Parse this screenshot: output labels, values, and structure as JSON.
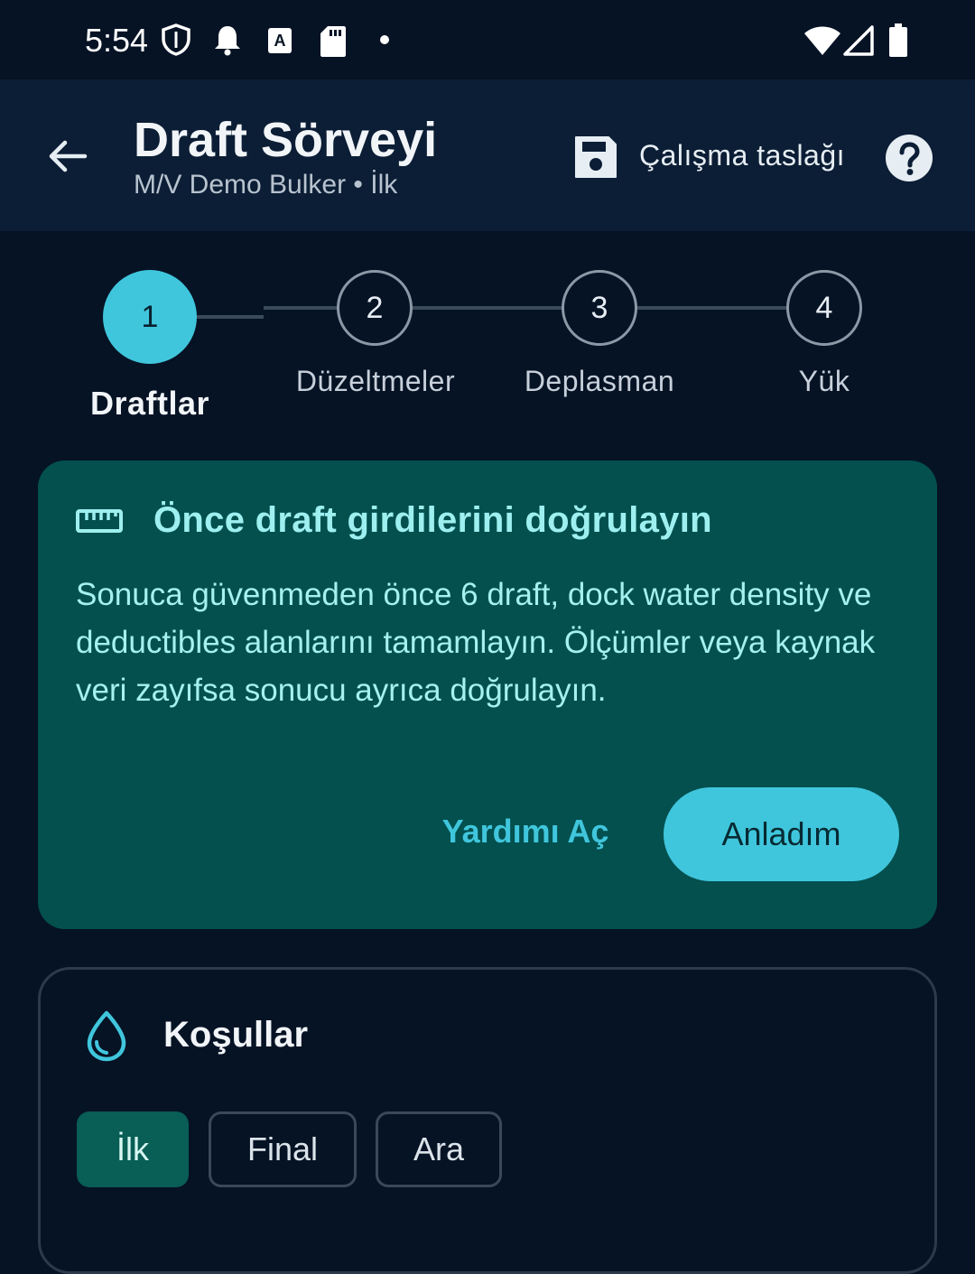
{
  "status_bar": {
    "time": "5:54",
    "icons": [
      "shield-icon",
      "bell-icon",
      "a-keyboard-icon",
      "sd-card-icon",
      "dot-icon",
      "wifi-icon",
      "signal-icon",
      "battery-icon"
    ]
  },
  "app_bar": {
    "title": "Draft Sörveyi",
    "subtitle": "M/V Demo Bulker • İlk",
    "save_label": "Çalışma taslağı"
  },
  "stepper": {
    "steps": [
      {
        "number": "1",
        "label": "Draftlar",
        "active": true
      },
      {
        "number": "2",
        "label": "Düzeltmeler",
        "active": false
      },
      {
        "number": "3",
        "label": "Deplasman",
        "active": false
      },
      {
        "number": "4",
        "label": "Yük",
        "active": false
      }
    ]
  },
  "info_card": {
    "title": "Önce draft girdilerini doğrulayın",
    "body": "Sonuca güvenmeden önce 6 draft, dock water density ve deductibles alanlarını tamamlayın. Ölçümler veya kaynak veri zayıfsa sonucu ayrıca doğrulayın.",
    "help_link": "Yardımı Aç",
    "ok_button": "Anladım"
  },
  "conditions": {
    "title": "Koşullar",
    "chips": [
      {
        "label": "İlk",
        "selected": true
      },
      {
        "label": "Final",
        "selected": false
      },
      {
        "label": "Ara",
        "selected": false
      }
    ]
  },
  "colors": {
    "background": "#061325",
    "app_bar": "#0c1e35",
    "accent": "#40c6dc",
    "info_card": "#03504f",
    "chip_selected": "#095e55"
  }
}
